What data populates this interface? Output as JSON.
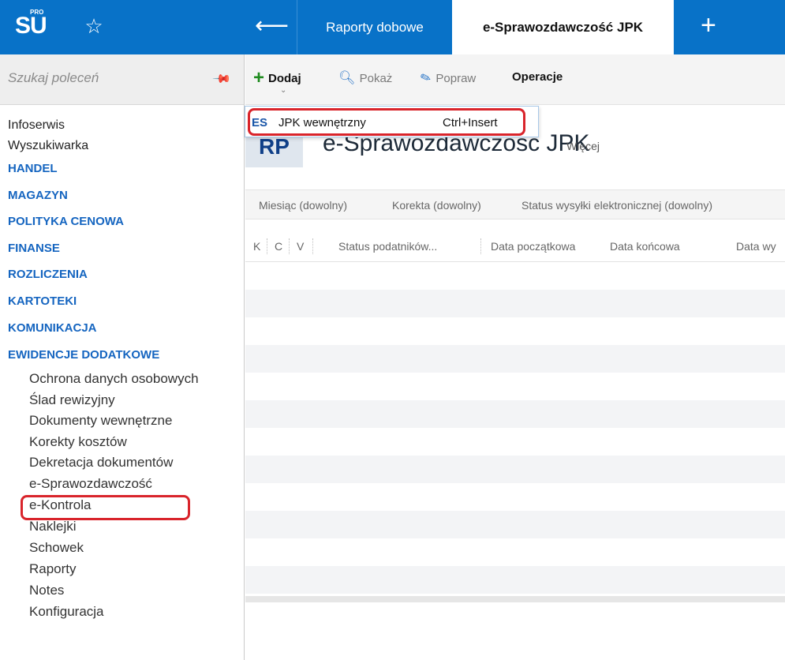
{
  "header": {
    "logo": "SU",
    "logo_badge": "PRO",
    "tabs": [
      {
        "label": "Raporty dobowe"
      },
      {
        "label": "e-Sprawozdawczość JPK"
      }
    ]
  },
  "sidebar": {
    "search_placeholder": "Szukaj poleceń",
    "items": [
      {
        "label": "Infoserwis",
        "type": "item"
      },
      {
        "label": "Wyszukiwarka",
        "type": "item"
      },
      {
        "label": "HANDEL",
        "type": "category"
      },
      {
        "label": "MAGAZYN",
        "type": "category"
      },
      {
        "label": "POLITYKA CENOWA",
        "type": "category"
      },
      {
        "label": "FINANSE",
        "type": "category"
      },
      {
        "label": "ROZLICZENIA",
        "type": "category"
      },
      {
        "label": "KARTOTEKI",
        "type": "category"
      },
      {
        "label": "KOMUNIKACJA",
        "type": "category"
      },
      {
        "label": "EWIDENCJE DODATKOWE",
        "type": "category"
      }
    ],
    "subitems": [
      {
        "label": "Ochrona danych osobowych"
      },
      {
        "label": "Ślad rewizyjny"
      },
      {
        "label": "Dokumenty wewnętrzne"
      },
      {
        "label": "Korekty kosztów"
      },
      {
        "label": "Dekretacja dokumentów"
      },
      {
        "label": "e-Sprawozdawczość",
        "highlighted": true
      },
      {
        "label": "e-Kontrola"
      },
      {
        "label": "Naklejki"
      },
      {
        "label": "Schowek"
      },
      {
        "label": "Raporty"
      },
      {
        "label": "Notes"
      },
      {
        "label": "Konfiguracja"
      }
    ]
  },
  "toolbar": {
    "add": "Dodaj",
    "show": "Pokaż",
    "fix": "Popraw",
    "operations": "Operacje"
  },
  "dropdown": {
    "code": "ES",
    "label": "JPK wewnętrzny",
    "shortcut": "Ctrl+Insert"
  },
  "page": {
    "badge": "RP",
    "title": "e-Sprawozdawczość JPK",
    "more": "Więcej"
  },
  "filters": [
    "Miesiąc (dowolny)",
    "Korekta (dowolny)",
    "Status wysyłki elektronicznej (dowolny)"
  ],
  "columns": [
    "K",
    "C",
    "V",
    "Status podatników...",
    "Data początkowa",
    "Data końcowa",
    "Data wy"
  ],
  "colors": {
    "topbar": "#0872c8",
    "category": "#1565c0",
    "highlight": "#d9242b",
    "add_icon": "#1f8b1f"
  }
}
